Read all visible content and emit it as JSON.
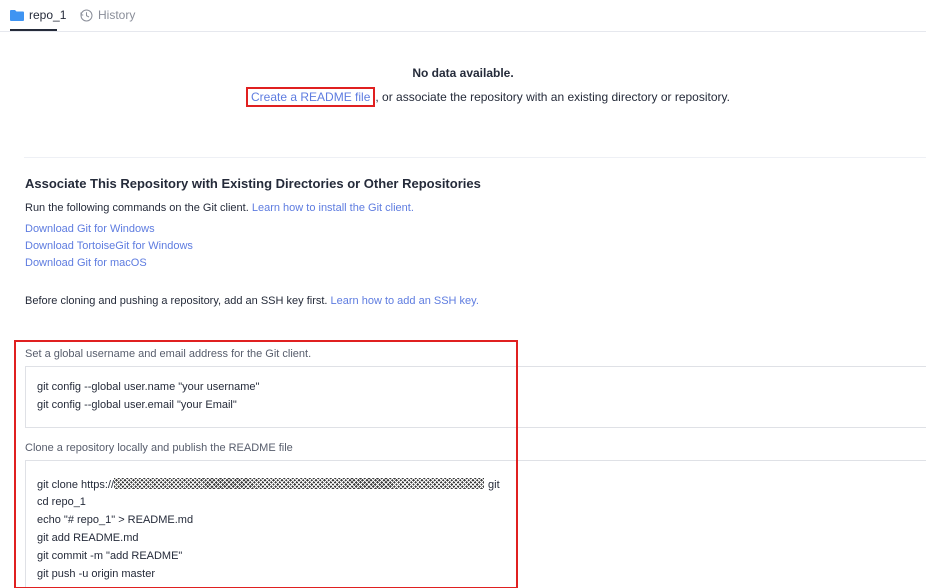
{
  "tabs": [
    {
      "label": "repo_1",
      "icon": "folder-icon",
      "active": true
    },
    {
      "label": "History",
      "icon": "history-icon",
      "active": false
    }
  ],
  "empty_state": {
    "title": "No data available.",
    "readme_link": "Create a README file",
    "rest_text": ", or associate the repository with an existing directory or repository."
  },
  "associate": {
    "title": "Associate This Repository with Existing Directories or Other Repositories",
    "run_text": "Run the following commands on the Git client.",
    "install_link": "Learn how to install the Git client.",
    "downloads": [
      "Download Git for Windows",
      "Download TortoiseGit for Windows",
      "Download Git for macOS"
    ],
    "ssh_text": "Before cloning and pushing a repository, add an SSH key first.",
    "ssh_link": "Learn how to add an SSH key."
  },
  "commands": {
    "global_label": "Set a global username and email address for the Git client.",
    "global_lines": [
      "git config --global user.name \"your username\"",
      "git config --global user.email \"your Email\""
    ],
    "clone_label": "Clone a repository locally and publish the README file",
    "clone_prefix": "git clone https://",
    "clone_suffix": "git",
    "clone_lines": [
      "cd repo_1",
      "echo \"# repo_1\" > README.md",
      "git add README.md",
      "git commit -m \"add README\"",
      "git push -u origin master"
    ]
  },
  "colors": {
    "link": "#5e7ce0",
    "highlight": "#e02020",
    "folder": "#3f94f2"
  }
}
